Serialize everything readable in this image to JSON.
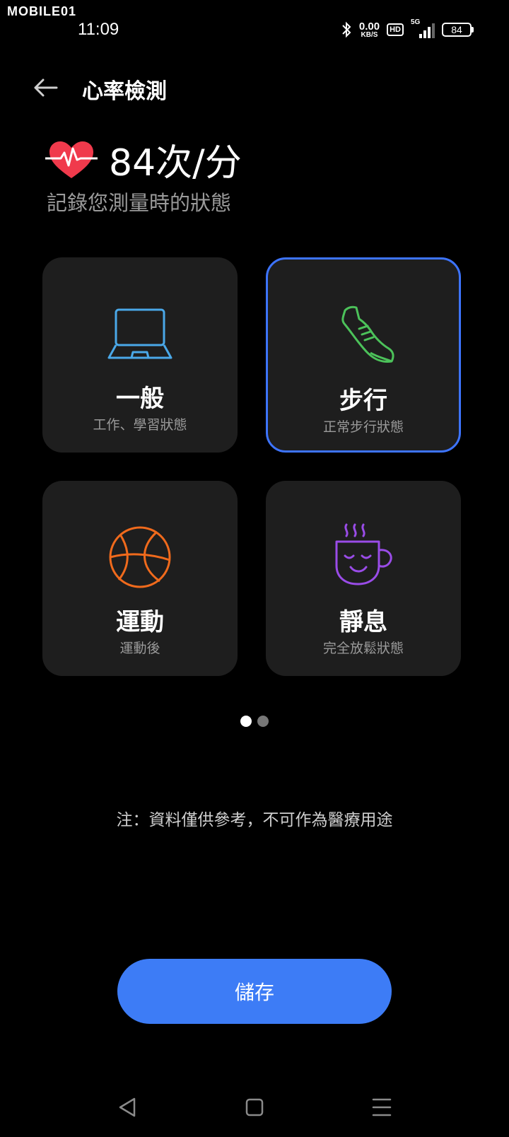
{
  "status_bar": {
    "watermark": "MOBILE01",
    "time": "11:09",
    "net_speed_value": "0.00",
    "net_speed_unit": "KB/S",
    "hd_label": "HD",
    "network_label": "5G",
    "battery": "84"
  },
  "header": {
    "title": "心率檢測"
  },
  "heart_rate": {
    "value": "84次/分",
    "subtitle": "記錄您測量時的狀態"
  },
  "states": [
    {
      "title": "一般",
      "desc": "工作、學習狀態",
      "icon": "laptop-icon",
      "color": "#4aa8e8",
      "selected": false
    },
    {
      "title": "步行",
      "desc": "正常步行狀態",
      "icon": "shoe-icon",
      "color": "#4cc25a",
      "selected": true
    },
    {
      "title": "運動",
      "desc": "運動後",
      "icon": "basketball-icon",
      "color": "#f06a1c",
      "selected": false
    },
    {
      "title": "靜息",
      "desc": "完全放鬆狀態",
      "icon": "coffee-cup-icon",
      "color": "#9a4ce8",
      "selected": false
    }
  ],
  "pagination": {
    "current": 1,
    "total": 2
  },
  "note": "注：資料僅供參考，不可作為醫療用途",
  "save_label": "儲存",
  "colors": {
    "accent": "#3d7cf6",
    "selected_border": "#3d74ff",
    "heart": "#f03a4c"
  }
}
